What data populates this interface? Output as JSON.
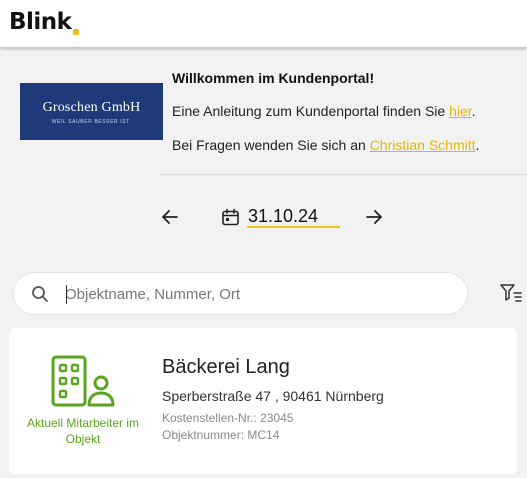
{
  "header": {
    "logo_text": "Blink",
    "accent_color": "#f2c21b"
  },
  "welcome": {
    "company_name": "Groschen GmbH",
    "company_tagline": "WEIL SAUBER BESSER IST.",
    "title": "Willkommen im Kundenportal!",
    "guide_prefix": "Eine Anleitung zum Kundenportal finden Sie ",
    "guide_link": "hier",
    "guide_suffix": ".",
    "contact_prefix": "Bei Fragen wenden Sie sich an ",
    "contact_link": "Christian Schmitt",
    "contact_suffix": "."
  },
  "date_nav": {
    "date": "31.10.24",
    "prev_icon": "arrow-left-icon",
    "next_icon": "arrow-right-icon",
    "calendar_icon": "calendar-icon"
  },
  "search": {
    "placeholder": "Objektname, Nummer, Ort",
    "value": "",
    "icon": "search-icon",
    "filter_icon": "filter-icon"
  },
  "objects": [
    {
      "name": "Bäckerei Lang",
      "address": "Sperberstraße 47 , 90461 Nürnberg",
      "cost_center": "Kostenstellen-Nr.: 23045",
      "object_number": "Objektnummer: MC14",
      "staff_status": "Aktuell Mitarbeiter im Objekt",
      "status_color": "#5aa51e",
      "icon": "building-person-icon"
    }
  ]
}
